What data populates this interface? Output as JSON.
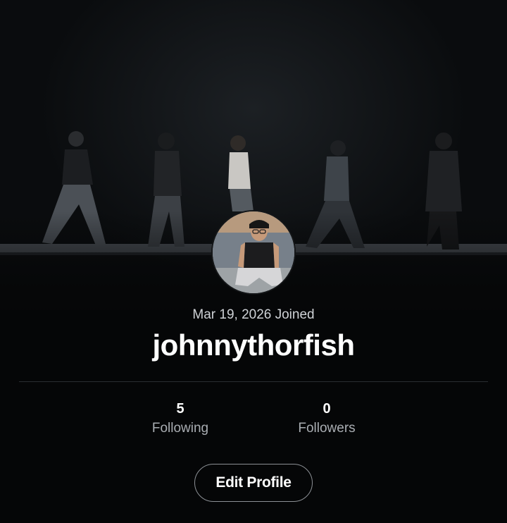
{
  "profile": {
    "joined": "Mar 19, 2026 Joined",
    "username": "johnnythorfish",
    "cover_image": "runway-models-walking",
    "avatar_image": "man-with-glasses-sitting"
  },
  "stats": {
    "following_count": "5",
    "following_label": "Following",
    "followers_count": "0",
    "followers_label": "Followers"
  },
  "actions": {
    "edit_profile_label": "Edit Profile"
  }
}
